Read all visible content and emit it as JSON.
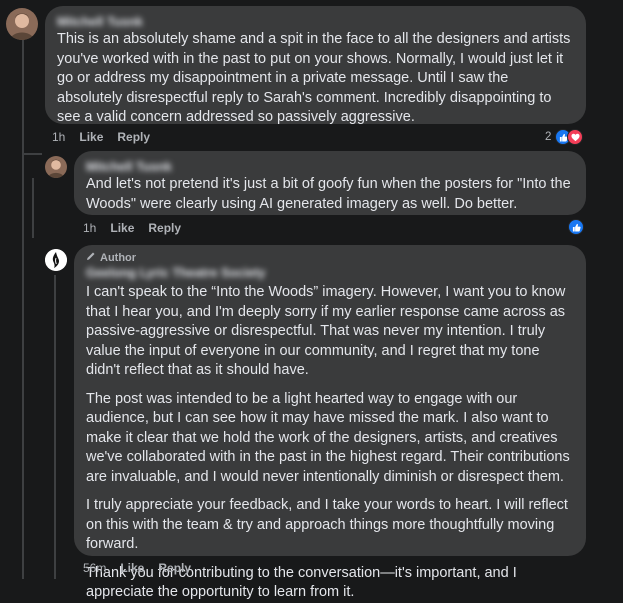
{
  "comments": [
    {
      "author": "Mitchell Tusnk",
      "paragraphs": [
        "This is an absolutely shame and a spit in the face to all the designers and artists you've worked with in the past to put on your shows. Normally, I would just let it go or address my disappointment in a private message. Until I saw the absolutely disrespectful reply to Sarah's comment. Incredibly disappointing to see a valid concern addressed so passively aggressive."
      ],
      "time": "1h",
      "like_label": "Like",
      "reply_label": "Reply",
      "reaction_count": "2",
      "reactions": [
        "like-icon",
        "love-icon"
      ]
    },
    {
      "author": "Mitchell Tusnk",
      "paragraphs": [
        "And let's not pretend it's just a bit of goofy fun when the posters for \"Into the Woods\" were clearly using AI generated imagery as well. Do better."
      ],
      "time": "1h",
      "like_label": "Like",
      "reply_label": "Reply",
      "reactions": [
        "like-icon"
      ]
    },
    {
      "author_badge": "Author",
      "author": "Geelong Lyric Theatre Society",
      "paragraphs": [
        "I can't speak to the “Into the Woods” imagery. However, I want you to know that I hear you, and I'm deeply sorry if my earlier response came across as passive-aggressive or disrespectful. That was never my intention. I truly value the input of everyone in our community, and I regret that my tone didn't reflect that as it should have.",
        "The post was intended to be a light hearted way to engage with our audience, but I can see how it may have missed the mark. I also want to make it clear that we hold the work of the designers, artists, and creatives we've collaborated with in the past in the highest regard. Their contributions are invaluable, and I would never intentionally diminish or disrespect them.",
        "I truly appreciate your feedback, and I take your words to heart. I will reflect on this with the team & try and approach things more thoughtfully moving forward.",
        "Thank you for contributing to the conversation—it's important, and I appreciate the opportunity to learn from it."
      ],
      "time": "56m",
      "like_label": "Like",
      "reply_label": "Reply"
    }
  ],
  "colors": {
    "background": "#18191a",
    "bubble": "#3a3b3c",
    "like": "#1877f2",
    "love": "#f33e58"
  }
}
